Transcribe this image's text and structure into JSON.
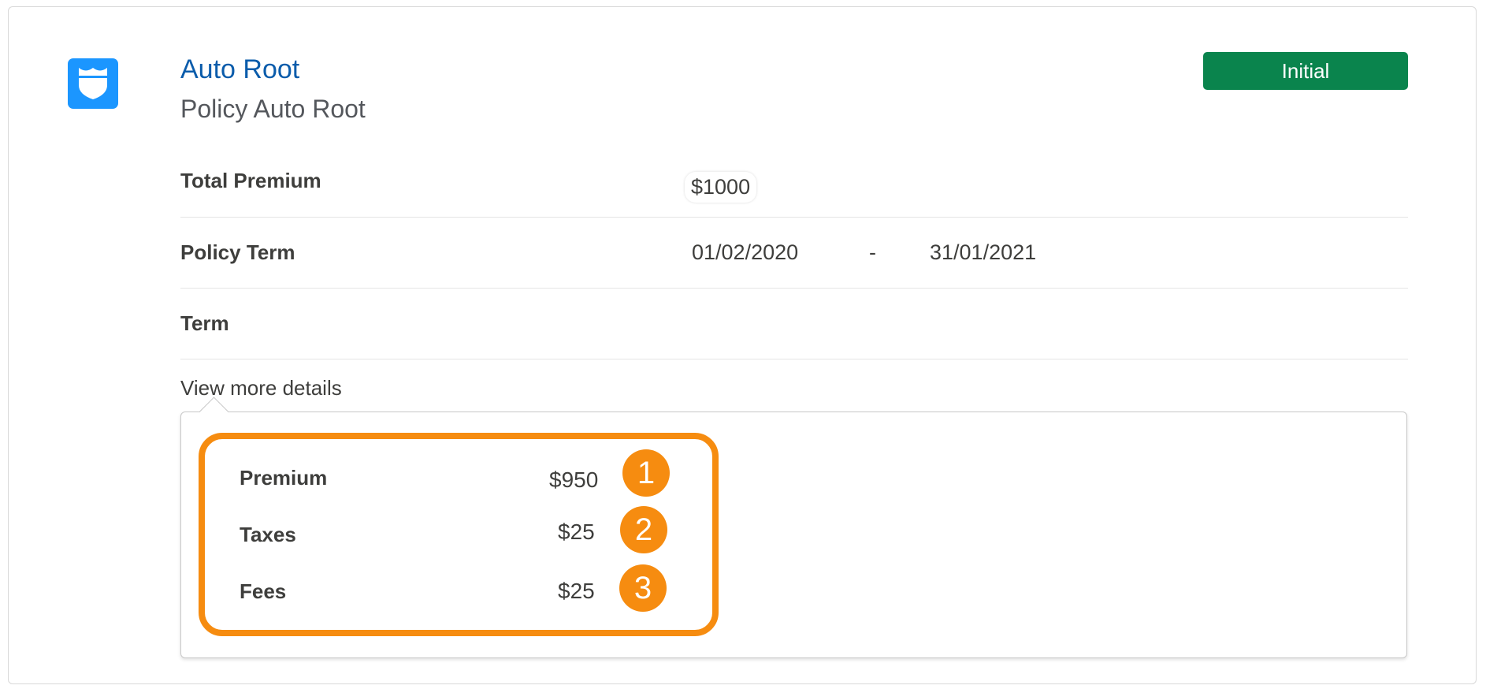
{
  "header": {
    "title": "Auto Root",
    "subtitle": "Policy Auto Root",
    "status": "Initial",
    "icon": "shield-icon"
  },
  "details": {
    "total_premium_label": "Total Premium",
    "total_premium_value": "$1000",
    "policy_term_label": "Policy Term",
    "policy_term_start": "01/02/2020",
    "policy_term_separator": "-",
    "policy_term_end": "31/01/2021",
    "term_label": "Term"
  },
  "view_more": {
    "label": "View more details",
    "breakdown": [
      {
        "label": "Premium",
        "value": "$950",
        "callout": "1"
      },
      {
        "label": "Taxes",
        "value": "$25",
        "callout": "2"
      },
      {
        "label": "Fees",
        "value": "$25",
        "callout": "3"
      }
    ]
  },
  "colors": {
    "title_link": "#0b5cab",
    "status_green": "#0a844d",
    "icon_blue": "#1b96ff",
    "highlight_orange": "#f68c10"
  }
}
